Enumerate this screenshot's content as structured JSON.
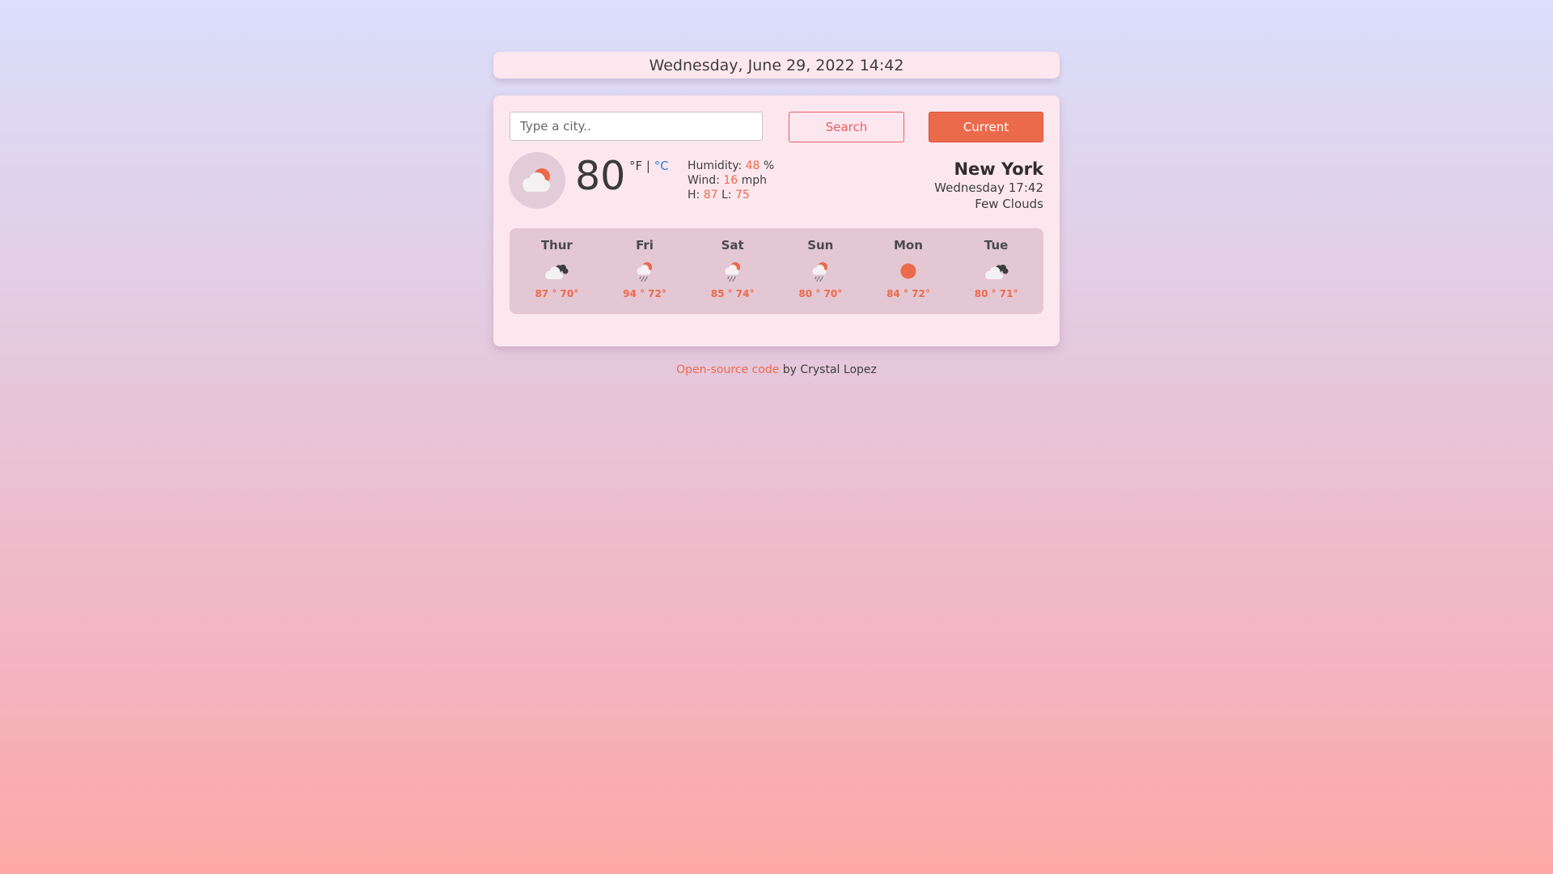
{
  "date_bar": {
    "text": "Wednesday, June 29, 2022 14:42"
  },
  "search": {
    "placeholder": "Type a city..",
    "search_label": "Search",
    "current_label": "Current"
  },
  "current": {
    "icon": "few-clouds-day-icon",
    "temperature": "80",
    "unit_f": "°F",
    "unit_separator": "|",
    "unit_c": "°C",
    "humidity_label": "Humidity:",
    "humidity_value": "48",
    "humidity_unit": "%",
    "wind_label": "Wind:",
    "wind_value": "16",
    "wind_unit": "mph",
    "high_label": "H:",
    "high_value": "87",
    "low_label": "L:",
    "low_value": "75",
    "city": "New York",
    "datetime": "Wednesday 17:42",
    "description": "Few Clouds"
  },
  "forecast": [
    {
      "day": "Thur",
      "icon": "broken-clouds-icon",
      "temps": "87 ° 70°"
    },
    {
      "day": "Fri",
      "icon": "rain-day-icon",
      "temps": "94 ° 72°"
    },
    {
      "day": "Sat",
      "icon": "rain-day-icon",
      "temps": "85 ° 74°"
    },
    {
      "day": "Sun",
      "icon": "rain-day-icon",
      "temps": "80 ° 70°"
    },
    {
      "day": "Mon",
      "icon": "clear-sky-icon",
      "temps": "84 ° 72°"
    },
    {
      "day": "Tue",
      "icon": "broken-clouds-icon",
      "temps": "80 ° 71°"
    }
  ],
  "footer": {
    "link_text": "Open-source code",
    "author_text": " by Crystal Lopez"
  },
  "colors": {
    "accent": "#ec6a4c",
    "card": "#fde7ee",
    "forecast_panel": "#e3c7d3",
    "celsius_link": "#2f7fd6"
  }
}
